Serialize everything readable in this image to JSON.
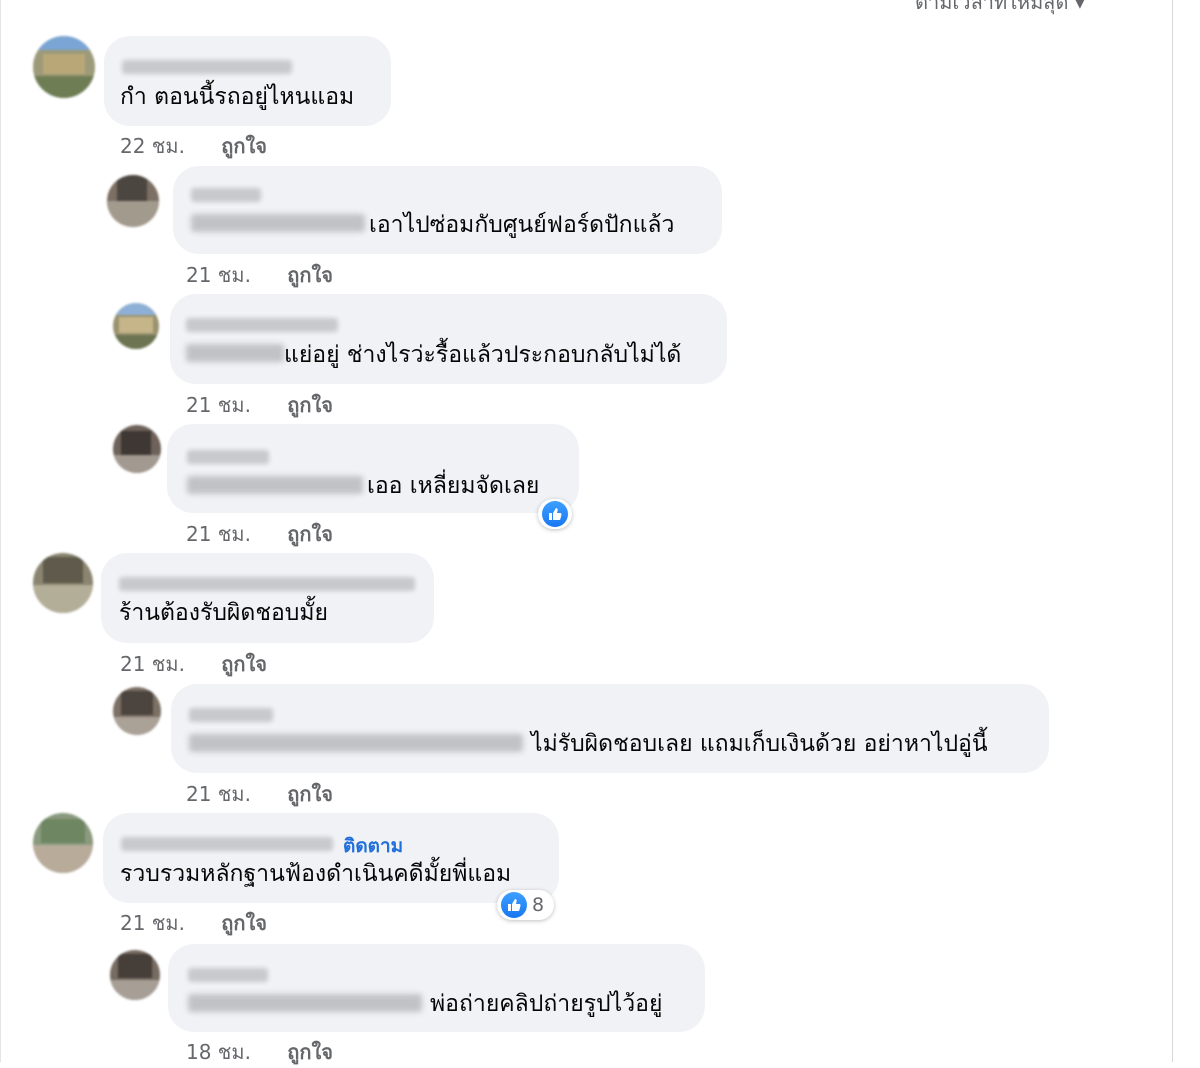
{
  "header": {
    "clipped_text": "ตามเวลาที่ใหม่สุด ▾"
  },
  "like_label": "ถูกใจ",
  "comments": [
    {
      "text": "กำ ตอนนี้รถอยู่ไหนแอม",
      "time": "22 ชม.",
      "level": 0
    },
    {
      "text": "เอาไปซ่อมกับศูนย์ฟอร์ดปักแล้ว",
      "time": "21 ชม.",
      "level": 1
    },
    {
      "text": "แย่อยู่ ช่างไรว่ะรื้อแล้วประกอบกลับไม่ได้",
      "time": "21 ชม.",
      "level": 1
    },
    {
      "text": "เออ เหลี่ยมจัดเลย",
      "time": "21 ชม.",
      "level": 1,
      "reaction": {
        "icon": "like-icon"
      }
    },
    {
      "text": "ร้านต้องรับผิดชอบมั้ย",
      "time": "21 ชม.",
      "level": 0
    },
    {
      "text": "ไม่รับผิดชอบเลย แถมเก็บเงินด้วย อย่าหาไปอู่นี้",
      "time": "21 ชม.",
      "level": 1
    },
    {
      "text": "รวบรวมหลักฐานฟ้องดำเนินคดีมั้ยพี่แอม",
      "time": "21 ชม.",
      "level": 0,
      "follow": "ติดตาม",
      "reaction": {
        "icon": "like-icon",
        "count": "8"
      }
    },
    {
      "text": "พ่อถ่ายคลิปถ่ายรูปไว้อยู่",
      "time": "18 ชม.",
      "level": 1
    }
  ]
}
